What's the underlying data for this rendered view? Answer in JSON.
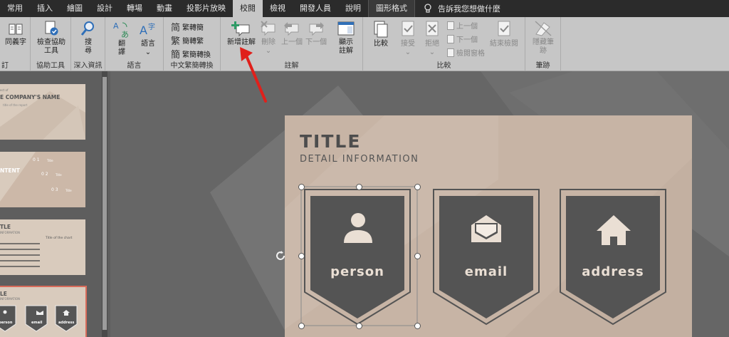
{
  "tabs": [
    {
      "label": "常用"
    },
    {
      "label": "插入"
    },
    {
      "label": "繪圖"
    },
    {
      "label": "設計"
    },
    {
      "label": "轉場"
    },
    {
      "label": "動畫"
    },
    {
      "label": "投影片放映"
    },
    {
      "label": "校閱",
      "active": true
    },
    {
      "label": "檢視"
    },
    {
      "label": "開發人員"
    },
    {
      "label": "說明"
    },
    {
      "label": "圖形格式"
    }
  ],
  "tellme": "告訴我您想做什麼",
  "ribbon": {
    "proofing": {
      "thesaurus": "同義字",
      "label": "訂"
    },
    "accessibility": {
      "check": "檢查協助工具",
      "check_line1": "檢查協助",
      "check_line2": "工具",
      "label": "協助工具"
    },
    "insights": {
      "smart_lookup": "搜尋",
      "smart_lookup_line1": "搜",
      "smart_lookup_line2": "尋",
      "label": "深入資訊"
    },
    "language": {
      "translate_line1": "翻",
      "translate_line2": "譯",
      "language_line1": "語言",
      "label": "語言"
    },
    "chinese": {
      "t2s": "繁轉簡",
      "s2t": "簡轉繁",
      "convert": "繁簡轉換",
      "label": "中文繁簡轉換"
    },
    "comments": {
      "new": "新增註解",
      "delete": "刪除",
      "prev": "上一個",
      "next": "下一個",
      "show_line1": "顯示",
      "show_line2": "註解",
      "label": "註解"
    },
    "compare": {
      "compare": "比較",
      "accept": "接受",
      "reject": "拒絕",
      "prev": "上一個",
      "next": "下一個",
      "pane": "檢閱窗格",
      "end": "結束檢閱",
      "label": "比較"
    },
    "ink": {
      "hide_line1": "隱藏筆",
      "hide_line2": "跡",
      "label": "筆跡"
    }
  },
  "thumbnails": [
    {
      "title": "E COMPANY'S NAME",
      "sub": "title of the report",
      "tag": "ect of"
    },
    {
      "title": "NTENT",
      "items": [
        "0 1",
        "0 2",
        "0 3"
      ],
      "item_label": "Title"
    },
    {
      "title": "TLE",
      "sub": "INFORMATION",
      "right_title": "Title of the chart"
    },
    {
      "title": "LE",
      "sub": "INFORMATION",
      "labels": [
        "person",
        "email",
        "address"
      ]
    }
  ],
  "slide": {
    "title": "TITLE",
    "subtitle": "DETAIL INFORMATION",
    "cards": [
      {
        "label": "person",
        "icon": "person-icon"
      },
      {
        "label": "email",
        "icon": "email-icon"
      },
      {
        "label": "address",
        "icon": "home-icon"
      }
    ]
  },
  "colors": {
    "accent_arrow": "#e0201b",
    "slide_bg": "#c7b4a5",
    "card_dark": "#545454",
    "card_text": "#eadfd4",
    "active_tab": "#c6c6c6",
    "thumb_selected": "#d86b5a"
  }
}
